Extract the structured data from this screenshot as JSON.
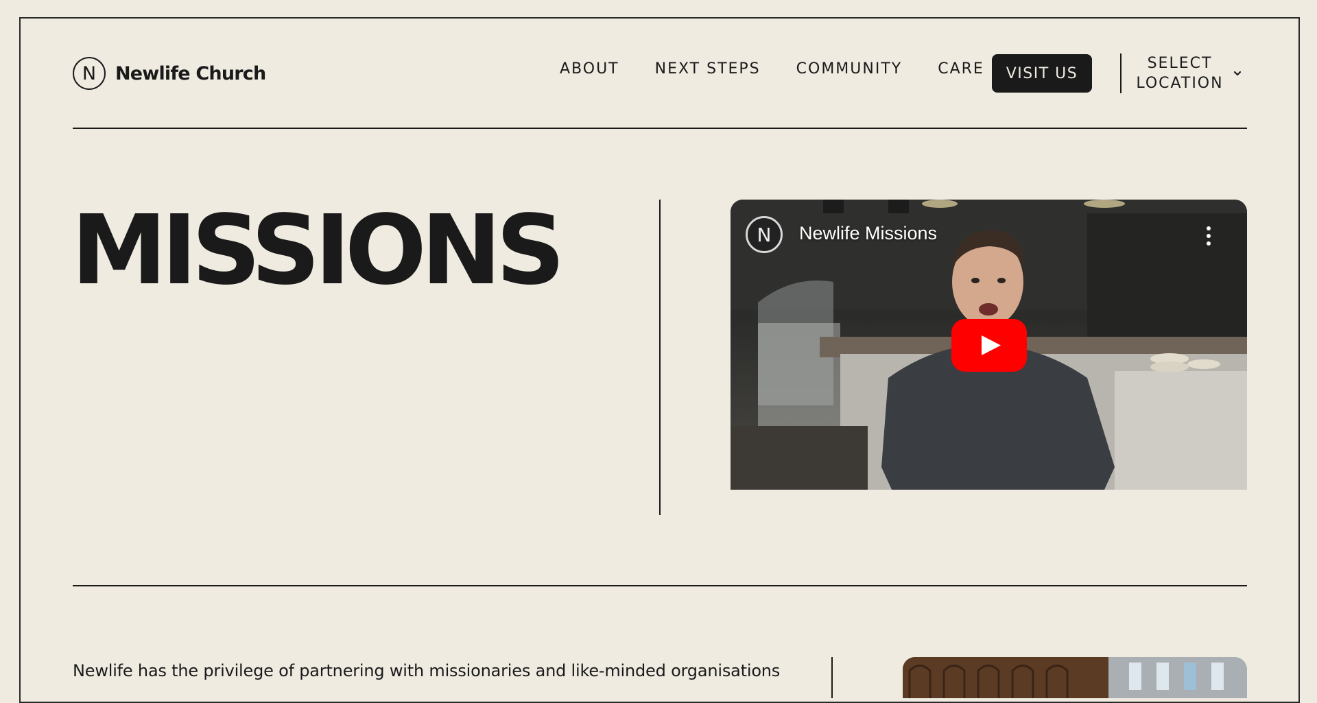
{
  "header": {
    "logo_letter": "N",
    "logo_text": "Newlife Church",
    "nav": [
      "ABOUT",
      "NEXT STEPS",
      "COMMUNITY",
      "CARE"
    ],
    "visit_label": "VISIT US",
    "location_line1": "SELECT",
    "location_line2": "LOCATION"
  },
  "hero": {
    "title": "MISSIONS",
    "video": {
      "channel_letter": "N",
      "title": "Newlife Missions"
    }
  },
  "intro": {
    "text": "Newlife has the privilege of partnering with missionaries and like-minded organisations"
  },
  "colors": {
    "background": "#efebe1",
    "ink": "#1a1a1a",
    "play_red": "#ff0000"
  }
}
